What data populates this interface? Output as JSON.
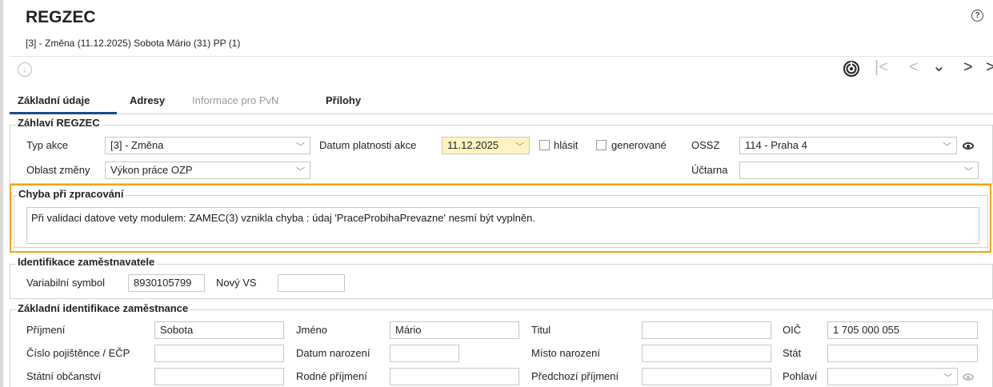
{
  "header": {
    "title": "REGZEC",
    "subtitle": "[3] - Změna (11.12.2025) Sobota Mário (31) PP (1)",
    "help_icon": "question-circle-icon"
  },
  "tabs": [
    {
      "label": "Základní údaje",
      "active": true
    },
    {
      "label": "Adresy"
    },
    {
      "label": "Informace pro PvN",
      "disabled": true
    },
    {
      "label": "Přílohy"
    }
  ],
  "header_group": {
    "title": "Záhlaví REGZEC",
    "typ_akce_label": "Typ akce",
    "typ_akce_value": "[3] - Změna",
    "datum_label": "Datum platnosti akce",
    "datum_value": "11.12.2025",
    "hlasit_label": "hlásit",
    "generovane_label": "generované",
    "ossz_label": "OSSZ",
    "ossz_value": "114 - Praha 4",
    "oblast_label": "Oblast změny",
    "oblast_value": "Výkon práce OZP",
    "uctarna_label": "Účtarna",
    "uctarna_value": ""
  },
  "error_group": {
    "title": "Chyba při zpracování",
    "message": "Při validaci datove vety modulem: ZAMEC(3) vznikla chyba : údaj 'PraceProbihaPrevazne' nesmí být vyplněn.",
    "highlight_color": "#f0a513"
  },
  "employer_group": {
    "title": "Identifikace zaměstnavatele",
    "vs_label": "Variabilní symbol",
    "vs_value": "8930105799",
    "novy_vs_label": "Nový VS",
    "novy_vs_value": ""
  },
  "employee_group": {
    "title": "Základní identifikace zaměstnance",
    "prijmeni_label": "Příjmení",
    "prijmeni_value": "Sobota",
    "jmeno_label": "Jméno",
    "jmeno_value": "Mário",
    "titul_label": "Titul",
    "titul_value": "",
    "oic_label": "OIČ",
    "oic_value": "1 705 000 055",
    "cislo_label": "Číslo pojištěnce / EČP",
    "cislo_value": "",
    "datum_nar_label": "Datum narození",
    "datum_nar_value": "",
    "misto_label": "Místo narození",
    "misto_value": "",
    "stat_label": "Stát",
    "stat_value": "",
    "obcanstvi_label": "Státní občanství",
    "obcanstvi_value": "",
    "rodne_label": "Rodné příjmení",
    "rodne_value": "",
    "predchozi_label": "Předchozí příjmení",
    "predchozi_value": "",
    "pohlavi_label": "Pohlaví",
    "pohlavi_value": ""
  },
  "icons": {
    "download": "download-circle-icon",
    "fingerprint": "fingerprint-icon",
    "first": "first-page-icon",
    "prev": "chevron-left-icon",
    "down": "chevron-down-icon",
    "next": "chevron-right-icon",
    "eye": "eye-icon"
  },
  "colors": {
    "accent": "#1e4a8c",
    "date_highlight": "#fff3c0"
  }
}
